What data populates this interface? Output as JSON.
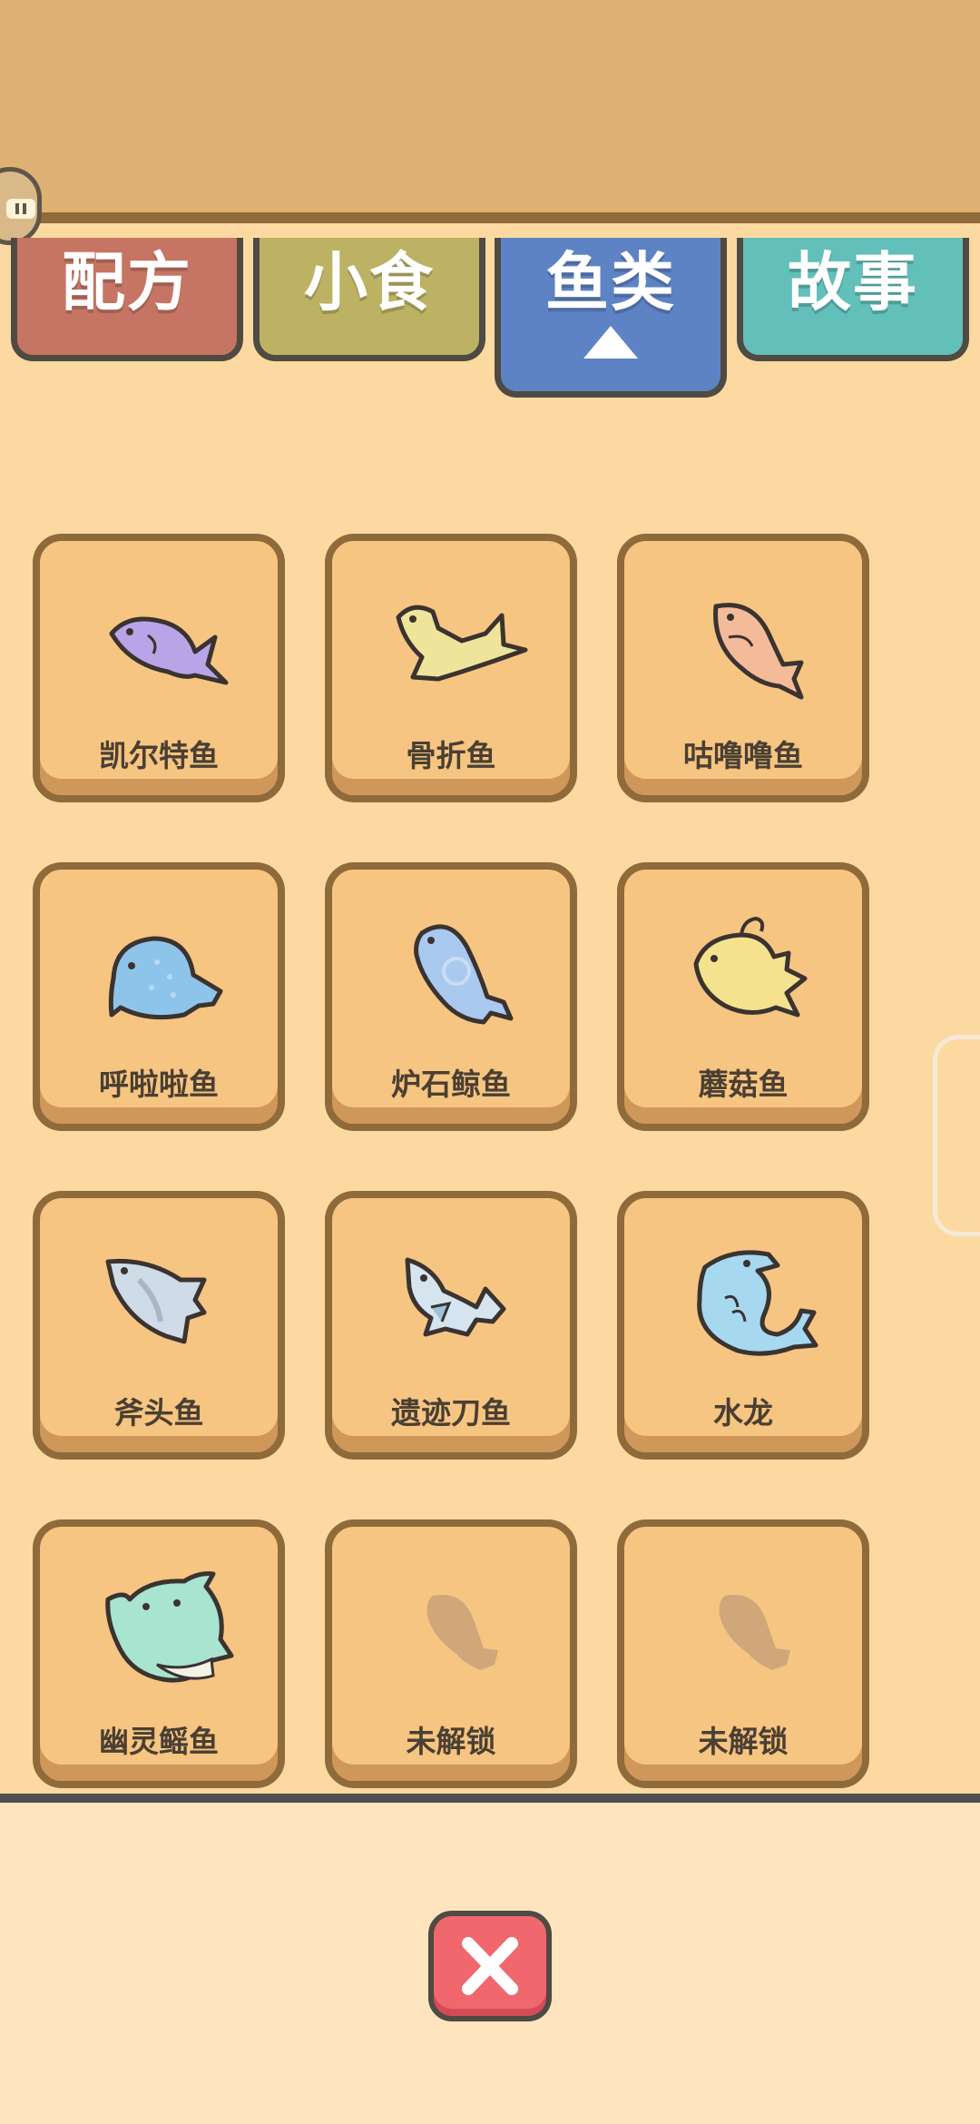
{
  "tabs": [
    {
      "label": "配方",
      "color": "#c67564"
    },
    {
      "label": "小食",
      "color": "#bdb263"
    },
    {
      "label": "鱼类",
      "color": "#5d83c4",
      "active": true
    },
    {
      "label": "故事",
      "color": "#62bfb9"
    }
  ],
  "fish": [
    {
      "name": "凯尔特鱼",
      "icon": "purple-fish-icon",
      "color": "#b9a4e8"
    },
    {
      "name": "骨折鱼",
      "icon": "yellow-bent-fish-icon",
      "color": "#efe59a"
    },
    {
      "name": "咕噜噜鱼",
      "icon": "peach-fish-icon",
      "color": "#f4bb9a"
    },
    {
      "name": "呼啦啦鱼",
      "icon": "blue-puffer-fish-icon",
      "color": "#8fc4ea"
    },
    {
      "name": "炉石鲸鱼",
      "icon": "blue-whale-fish-icon",
      "color": "#a9c9ee"
    },
    {
      "name": "蘑菇鱼",
      "icon": "yellow-mushroom-fish-icon",
      "color": "#f5e28e"
    },
    {
      "name": "斧头鱼",
      "icon": "gray-axe-fish-icon",
      "color": "#cfdbe6"
    },
    {
      "name": "遗迹刀鱼",
      "icon": "relic-blade-fish-icon",
      "color": "#d5e4ee"
    },
    {
      "name": "水龙",
      "icon": "water-dragon-icon",
      "color": "#a6d8ef"
    },
    {
      "name": "幽灵鳐鱼",
      "icon": "ghost-ray-fish-icon",
      "color": "#a8e4cf"
    },
    {
      "name": "未解锁",
      "icon": "locked-fish-silhouette-icon",
      "color": "#cfa77a"
    },
    {
      "name": "未解锁",
      "icon": "locked-fish-silhouette-icon",
      "color": "#cfa77a"
    }
  ],
  "close_icon": "close-icon"
}
